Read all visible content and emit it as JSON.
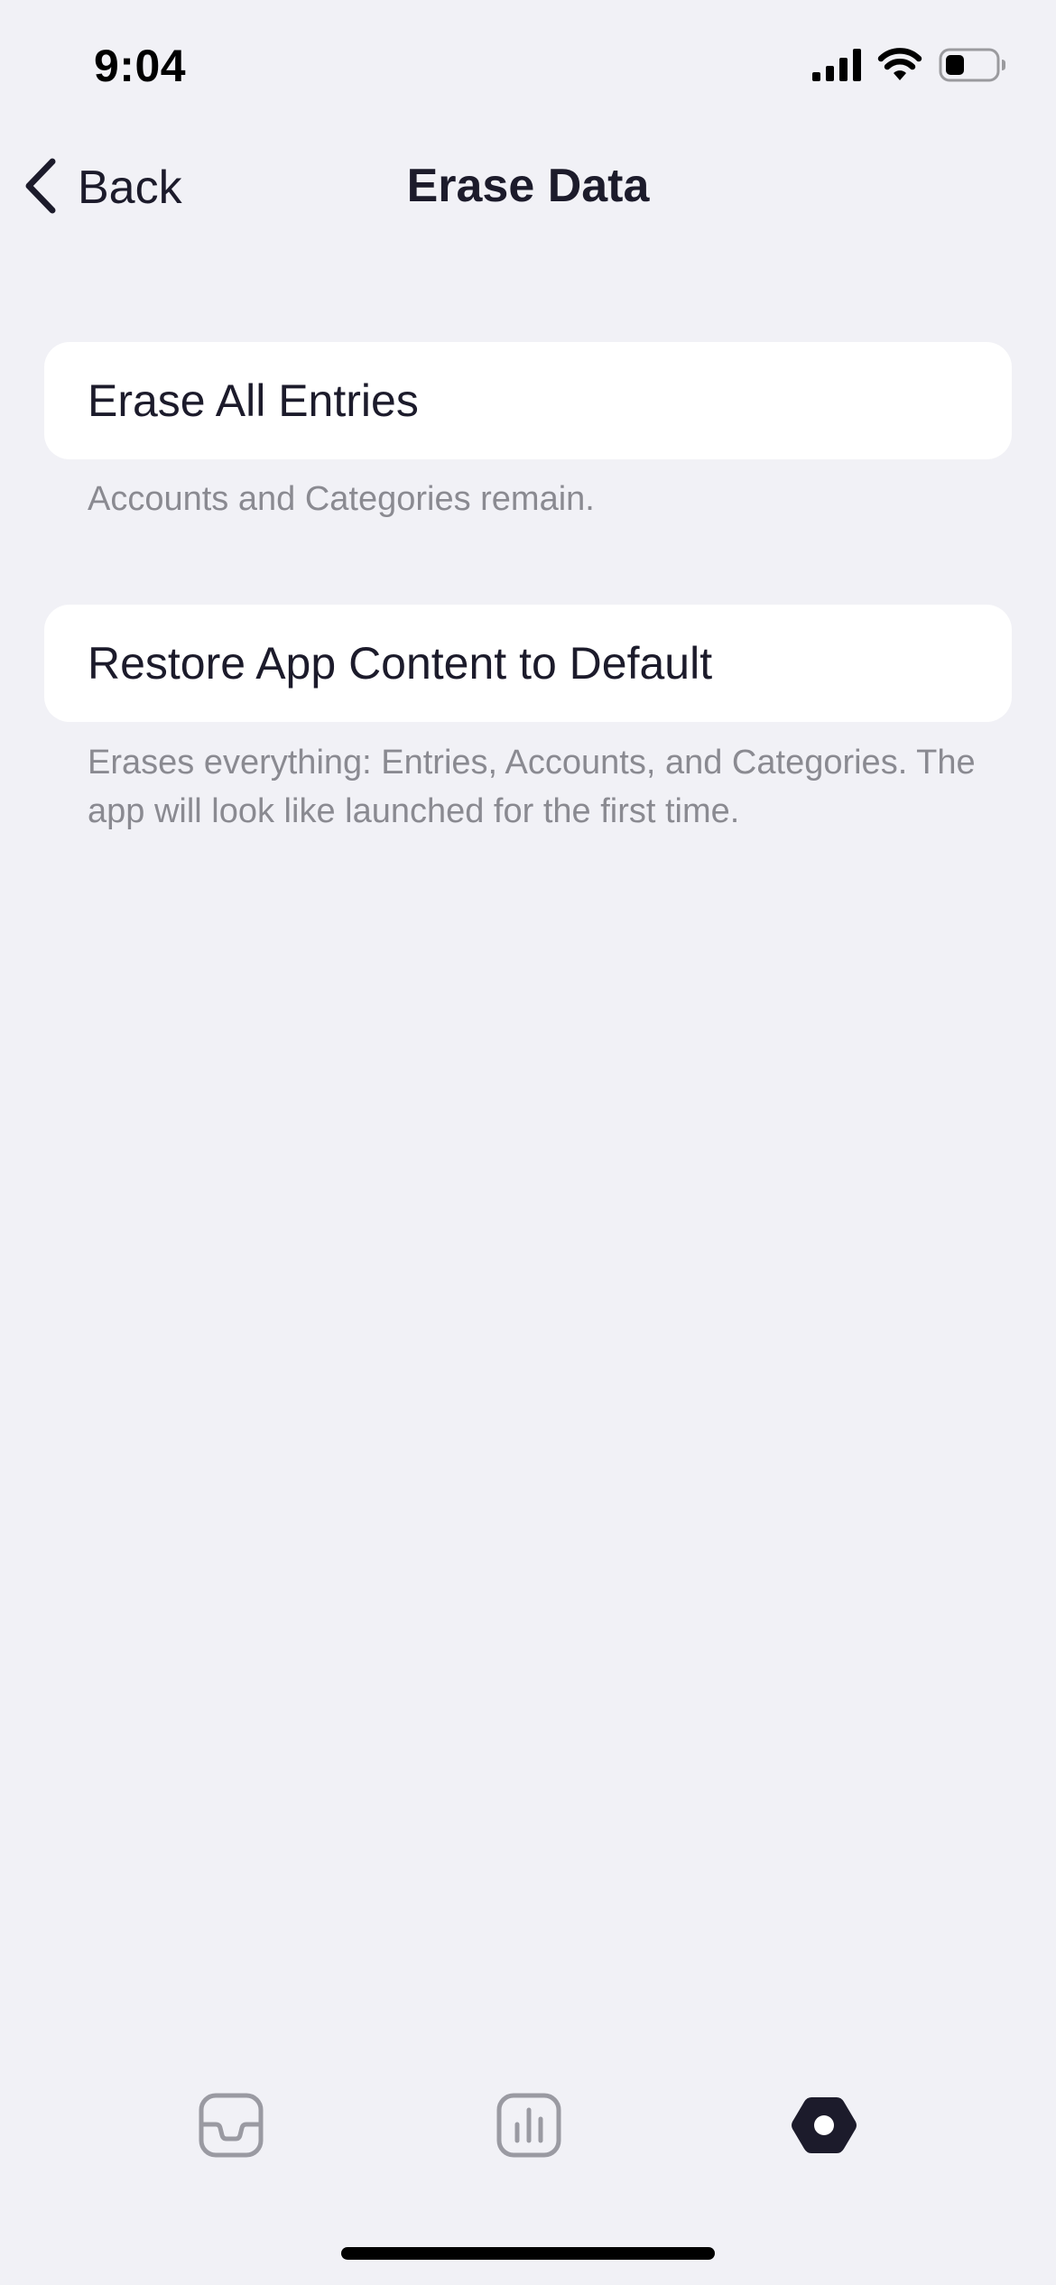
{
  "status_bar": {
    "time": "9:04",
    "icons": [
      "cellular-signal-icon",
      "wifi-icon",
      "battery-icon"
    ]
  },
  "nav": {
    "back_label": "Back",
    "title": "Erase Data"
  },
  "sections": [
    {
      "button_label": "Erase All Entries",
      "footnote": "Accounts and Categories remain."
    },
    {
      "button_label": "Restore App Content to Default",
      "footnote": "Erases everything: Entries, Accounts, and Categories. The app will look like launched for the first time."
    }
  ],
  "tab_bar": {
    "tabs": [
      {
        "icon": "inbox-tray-icon",
        "selected": false
      },
      {
        "icon": "bar-chart-icon",
        "selected": false
      },
      {
        "icon": "settings-hexagon-icon",
        "selected": true
      }
    ]
  },
  "colors": {
    "background": "#f1f1f6",
    "text_primary": "#1c1b2b",
    "text_secondary": "#8a8a91",
    "tab_inactive": "#9a9aa2",
    "tab_active": "#1c1b2b"
  }
}
